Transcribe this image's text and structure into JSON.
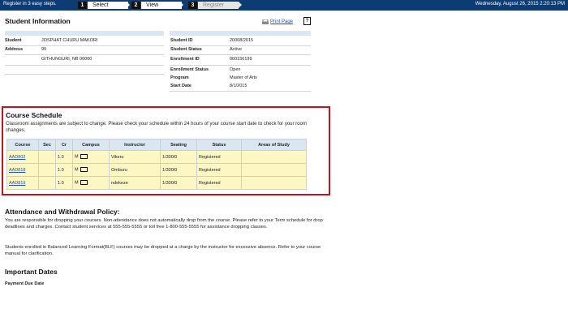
{
  "topbar": {
    "register_text": "Register in 3 easy steps.",
    "date_text": "Wednesday, August 26, 2015 2:20:13 PM",
    "steps": [
      {
        "num": "1",
        "label": "Select"
      },
      {
        "num": "2",
        "label": "View"
      },
      {
        "num": "3",
        "label": "Register"
      }
    ]
  },
  "student_info": {
    "title": "Student Information",
    "print_label": "Print Page",
    "help_label": "?",
    "left": [
      {
        "label": "Student",
        "value": "JOSPHAT CHURU MAKORI"
      },
      {
        "label": "Address",
        "value": "99"
      },
      {
        "label": "",
        "value": "GITHUNGURI,   NB   00000"
      }
    ],
    "right": [
      {
        "label": "Student ID",
        "value": "20008/2015"
      },
      {
        "label": "Student Status",
        "value": "Active"
      },
      {
        "label": "Enrollment ID",
        "value": "000156199"
      },
      {
        "label": "Enrollment Status",
        "value": "Open"
      },
      {
        "label": "Program",
        "value": "Master of Arts"
      },
      {
        "label": "Start Date",
        "value": "8/1/2015"
      }
    ]
  },
  "course_schedule": {
    "title": "Course Schedule",
    "note": "Classroom assignments are subject to change. Please check your schedule within 24 hours of your course start date to check for your room changes.",
    "columns": [
      "Course",
      "Sec",
      "Cr",
      "Campus",
      "Instructor",
      "Seating",
      "Status",
      "Areas of Study"
    ],
    "rows": [
      {
        "course": "AAD802",
        "sec": "",
        "cr": "1.0",
        "campus": "M",
        "instructor": "Vikeru",
        "seating": "1/300/0",
        "status": "Registered",
        "areas": ""
      },
      {
        "course": "AAD818",
        "sec": "",
        "cr": "1.0",
        "campus": "M",
        "instructor": "Omburu",
        "seating": "1/300/0",
        "status": "Registered",
        "areas": ""
      },
      {
        "course": "AAD819",
        "sec": "",
        "cr": "1.0",
        "campus": "M",
        "instructor": "ndekeze",
        "seating": "1/300/0",
        "status": "Registered",
        "areas": ""
      }
    ]
  },
  "attendance": {
    "title": "Attendance and Withdrawal Policy:",
    "p1": "You are responsible for dropping your courses. Non-attendance does not automatically drop from the course. Please refer to your Term schedule for drop deadlines and charges. Contact student services at 555-555-5555 or toll free 1-800-555-5555 for assistance dropping classes.",
    "p2": "Students enrolled in Balanced Learning Format(BLF) courses may be dropped at a charge by the instructor for excessive absence. Refer to your course manual for clarification."
  },
  "important": {
    "title": "Important Dates",
    "payment_label": "Payment Due Date"
  },
  "colors": {
    "topbar": "#0d3c74",
    "highlight_border": "#c0151f",
    "table_header": "#dbe6f3",
    "row_bg": "#fdf7c4",
    "link": "#1a4fb8"
  }
}
